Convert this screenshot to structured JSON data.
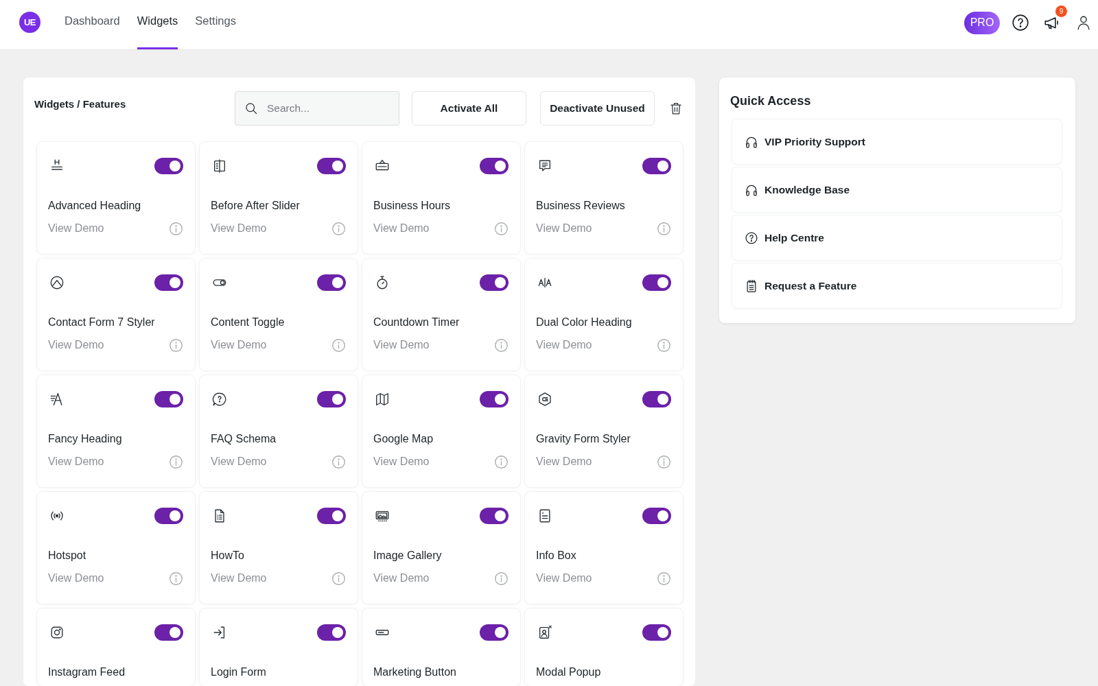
{
  "header": {
    "logo": "UE",
    "nav": [
      {
        "label": "Dashboard",
        "selected": false
      },
      {
        "label": "Widgets",
        "selected": true
      },
      {
        "label": "Settings",
        "selected": false
      }
    ],
    "pro_badge": "PRO",
    "notification_count": "9"
  },
  "widgets_panel": {
    "title": "Widgets / Features",
    "search": {
      "placeholder": "Search..."
    },
    "buttons": [
      "Activate All",
      "Deactivate Unused"
    ],
    "widgets": [
      {
        "name": "Advanced Heading",
        "enabled": true,
        "link": "View Demo"
      },
      {
        "name": "Before After Slider",
        "enabled": true,
        "link": "View Demo"
      },
      {
        "name": "Business Hours",
        "enabled": true,
        "link": "View Demo"
      },
      {
        "name": "Business Reviews",
        "enabled": true,
        "link": "View Demo"
      },
      {
        "name": "Contact Form 7 Styler",
        "enabled": true,
        "link": "View Demo"
      },
      {
        "name": "Content Toggle",
        "enabled": true,
        "link": "View Demo"
      },
      {
        "name": "Countdown Timer",
        "enabled": true,
        "link": "View Demo"
      },
      {
        "name": "Dual Color Heading",
        "enabled": true,
        "link": "View Demo"
      },
      {
        "name": "Fancy Heading",
        "enabled": true,
        "link": "View Demo"
      },
      {
        "name": "FAQ Schema",
        "enabled": true,
        "link": "View Demo"
      },
      {
        "name": "Google Map",
        "enabled": true,
        "link": "View Demo"
      },
      {
        "name": "Gravity Form Styler",
        "enabled": true,
        "link": "View Demo"
      },
      {
        "name": "Hotspot",
        "enabled": true,
        "link": "View Demo"
      },
      {
        "name": "HowTo",
        "enabled": true,
        "link": "View Demo"
      },
      {
        "name": "Image Gallery",
        "enabled": true,
        "link": "View Demo"
      },
      {
        "name": "Info Box",
        "enabled": true,
        "link": "View Demo"
      },
      {
        "name": "Instagram Feed",
        "enabled": true
      },
      {
        "name": "Login Form",
        "enabled": true
      },
      {
        "name": "Marketing Button",
        "enabled": true
      },
      {
        "name": "Modal Popup",
        "enabled": true
      }
    ]
  },
  "quick_access": {
    "title": "Quick Access",
    "items": [
      "VIP Priority Support",
      "Knowledge Base",
      "Help Centre",
      "Request a Feature"
    ]
  }
}
